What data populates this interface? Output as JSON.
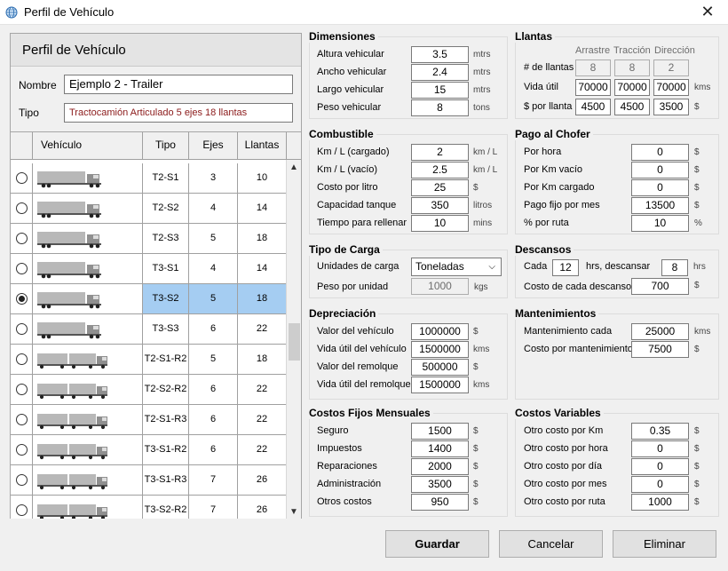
{
  "window": {
    "title": "Perfil de Vehículo",
    "close_glyph": "✕"
  },
  "left": {
    "header": "Perfil de Vehículo",
    "nombre_label": "Nombre",
    "nombre_value": "Ejemplo 2 - Trailer",
    "tipo_label": "Tipo",
    "tipo_value": "Tractocamión Articulado 5 ejes  18 llantas",
    "columns": [
      "Vehículo",
      "Tipo",
      "Ejes",
      "Llantas"
    ],
    "rows": [
      {
        "tipo": "T2-S1",
        "ejes": "3",
        "llantas": "10"
      },
      {
        "tipo": "T2-S2",
        "ejes": "4",
        "llantas": "14"
      },
      {
        "tipo": "T2-S3",
        "ejes": "5",
        "llantas": "18"
      },
      {
        "tipo": "T3-S1",
        "ejes": "4",
        "llantas": "14"
      },
      {
        "tipo": "T3-S2",
        "ejes": "5",
        "llantas": "18",
        "selected": true
      },
      {
        "tipo": "T3-S3",
        "ejes": "6",
        "llantas": "22"
      },
      {
        "tipo": "T2-S1-R2",
        "ejes": "5",
        "llantas": "18"
      },
      {
        "tipo": "T2-S2-R2",
        "ejes": "6",
        "llantas": "22"
      },
      {
        "tipo": "T2-S1-R3",
        "ejes": "6",
        "llantas": "22"
      },
      {
        "tipo": "T3-S1-R2",
        "ejes": "6",
        "llantas": "22"
      },
      {
        "tipo": "T3-S1-R3",
        "ejes": "7",
        "llantas": "26"
      },
      {
        "tipo": "T3-S2-R2",
        "ejes": "7",
        "llantas": "26"
      }
    ]
  },
  "dimensiones": {
    "title": "Dimensiones",
    "items": [
      {
        "label": "Altura vehicular",
        "value": "3.5",
        "unit": "mtrs"
      },
      {
        "label": "Ancho vehicular",
        "value": "2.4",
        "unit": "mtrs"
      },
      {
        "label": "Largo vehicular",
        "value": "15",
        "unit": "mtrs"
      },
      {
        "label": "Peso vehicular",
        "value": "8",
        "unit": "tons"
      }
    ]
  },
  "llantas": {
    "title": "Llantas",
    "cols": [
      "Arrastre",
      "Tracción",
      "Dirección"
    ],
    "rows": [
      {
        "label": "# de llantas",
        "values": [
          "8",
          "8",
          "2"
        ],
        "unit": ""
      },
      {
        "label": "Vida útil",
        "values": [
          "70000",
          "70000",
          "70000"
        ],
        "unit": "kms"
      },
      {
        "label": "$ por llanta",
        "values": [
          "4500",
          "4500",
          "3500"
        ],
        "unit": "$"
      }
    ]
  },
  "combustible": {
    "title": "Combustible",
    "items": [
      {
        "label": "Km / L (cargado)",
        "value": "2",
        "unit": "km / L"
      },
      {
        "label": "Km / L (vacío)",
        "value": "2.5",
        "unit": "km / L"
      },
      {
        "label": "Costo por litro",
        "value": "25",
        "unit": "$"
      },
      {
        "label": "Capacidad tanque",
        "value": "350",
        "unit": "litros"
      },
      {
        "label": "Tiempo para rellenar",
        "value": "10",
        "unit": "mins"
      }
    ]
  },
  "pago": {
    "title": "Pago al Chofer",
    "items": [
      {
        "label": "Por hora",
        "value": "0",
        "unit": "$"
      },
      {
        "label": "Por Km vacío",
        "value": "0",
        "unit": "$"
      },
      {
        "label": "Por Km cargado",
        "value": "0",
        "unit": "$"
      },
      {
        "label": "Pago fijo por mes",
        "value": "13500",
        "unit": "$"
      },
      {
        "label": "% por ruta",
        "value": "10",
        "unit": "%"
      }
    ]
  },
  "carga": {
    "title": "Tipo de Carga",
    "unidades_label": "Unidades de carga",
    "unidades_value": "Toneladas",
    "peso_label": "Peso por unidad",
    "peso_value": "1000",
    "peso_unit": "kgs"
  },
  "descansos": {
    "title": "Descansos",
    "cada_label": "Cada",
    "cada_value": "12",
    "hrs_label": "hrs, descansar",
    "desc_value": "8",
    "hrs_unit": "hrs",
    "costo_label": "Costo de cada descanso",
    "costo_value": "700",
    "costo_unit": "$"
  },
  "depreciacion": {
    "title": "Depreciación",
    "items": [
      {
        "label": "Valor del vehículo",
        "value": "1000000",
        "unit": "$"
      },
      {
        "label": "Vida útil del vehículo",
        "value": "1500000",
        "unit": "kms"
      },
      {
        "label": "Valor del remolque",
        "value": "500000",
        "unit": "$"
      },
      {
        "label": "Vida útil del remolque",
        "value": "1500000",
        "unit": "kms"
      }
    ]
  },
  "mantenimientos": {
    "title": "Mantenimientos",
    "items": [
      {
        "label": "Mantenimiento cada",
        "value": "25000",
        "unit": "kms"
      },
      {
        "label": "Costo por mantenimiento",
        "value": "7500",
        "unit": "$"
      }
    ]
  },
  "fijos": {
    "title": "Costos Fijos Mensuales",
    "items": [
      {
        "label": "Seguro",
        "value": "1500",
        "unit": "$"
      },
      {
        "label": "Impuestos",
        "value": "1400",
        "unit": "$"
      },
      {
        "label": "Reparaciones",
        "value": "2000",
        "unit": "$"
      },
      {
        "label": "Administración",
        "value": "3500",
        "unit": "$"
      },
      {
        "label": "Otros costos",
        "value": "950",
        "unit": "$"
      }
    ]
  },
  "variables": {
    "title": "Costos Variables",
    "items": [
      {
        "label": "Otro costo por Km",
        "value": "0.35",
        "unit": "$"
      },
      {
        "label": "Otro costo por hora",
        "value": "0",
        "unit": "$"
      },
      {
        "label": "Otro costo por día",
        "value": "0",
        "unit": "$"
      },
      {
        "label": "Otro costo por mes",
        "value": "0",
        "unit": "$"
      },
      {
        "label": "Otro costo por ruta",
        "value": "1000",
        "unit": "$"
      }
    ]
  },
  "buttons": {
    "guardar": "Guardar",
    "cancelar": "Cancelar",
    "eliminar": "Eliminar"
  },
  "icons": {
    "window": "globe-icon",
    "close": "close-icon",
    "scroll_up": "chevron-up-icon",
    "scroll_down": "chevron-down-icon",
    "dropdown": "chevron-down-icon",
    "vehicle": "truck-icon"
  }
}
